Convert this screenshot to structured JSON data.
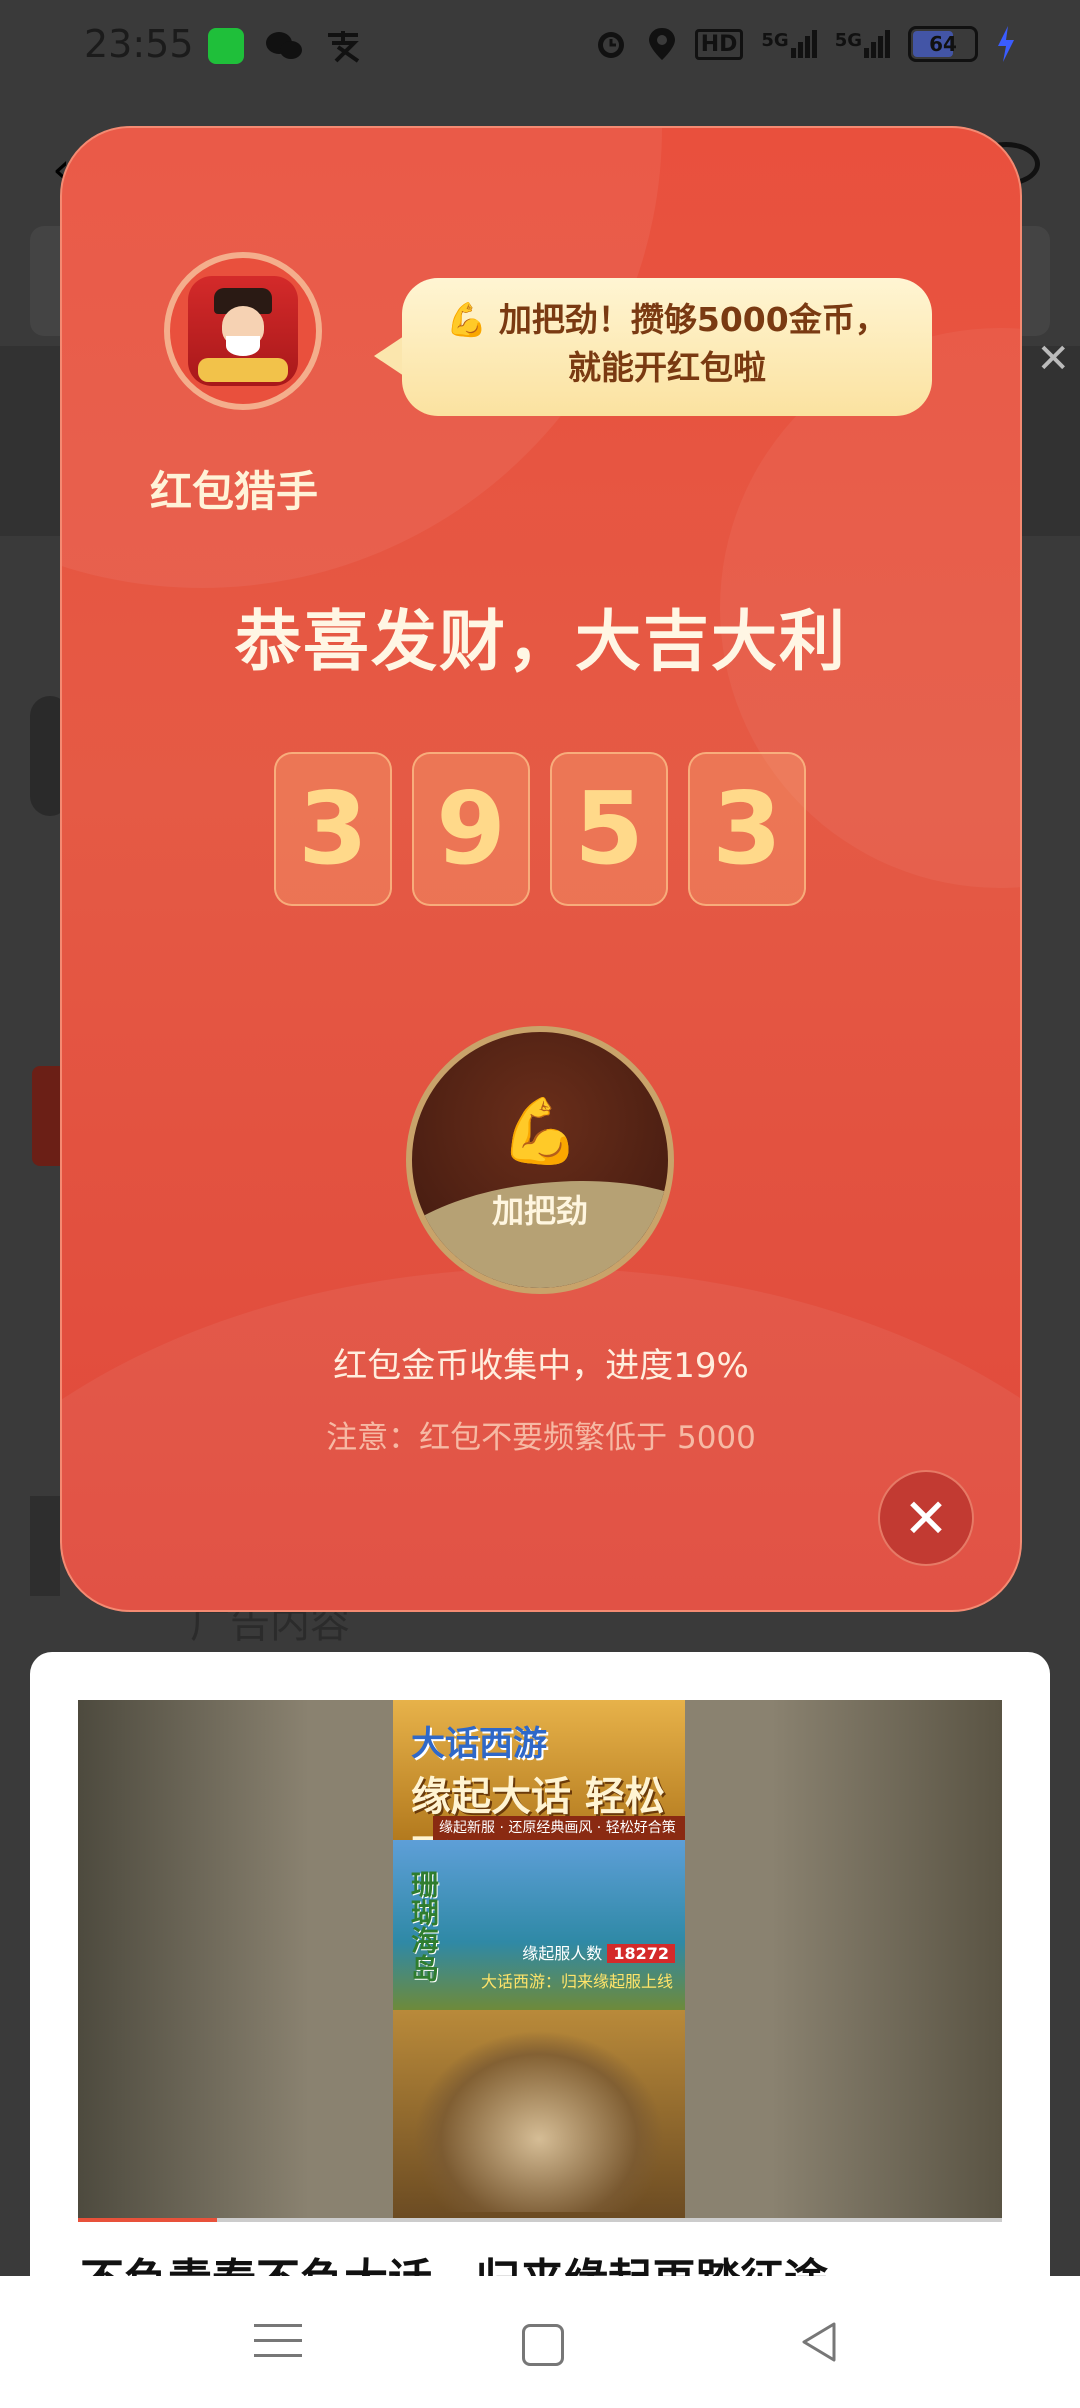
{
  "status_bar": {
    "time": "23:55",
    "left_icons": [
      "app-icon",
      "wechat-icon",
      "alipay-icon"
    ],
    "right_icons": [
      "alarm-icon",
      "location-icon",
      "hd-icon",
      "5g-signal-icon",
      "5g-signal-icon",
      "battery-icon",
      "charging-icon"
    ],
    "hd_label": "HD",
    "net1_label": "5G",
    "net2_label": "5G",
    "battery_level": "64"
  },
  "modal": {
    "hunter_name": "红包猎手",
    "bubble_line1": "💪 加把劲！攒够5000金币，",
    "bubble_line2": "就能开红包啦",
    "headline": "恭喜发财，大吉大利",
    "digits": [
      "3",
      "9",
      "5",
      "3"
    ],
    "boost_icon": "💪",
    "boost_label": "加把劲",
    "boost_fill_fraction": 0.19,
    "progress_text": "红包金币收集中，进度19%",
    "notice_text": "注意：红包不要频繁低于 5000",
    "close_label": "✕",
    "colors": {
      "background": "#e9503d",
      "digit_text": "#ffd98a",
      "bubble": "#fff5d3"
    }
  },
  "background_page": {
    "ad_label": "广告内容"
  },
  "ad_card": {
    "poster_title": "大话西游",
    "poster_slogan": "缘起大话 轻松西游",
    "poster_sub": "缘起新服 · 还原经典画风 · 轻松好合策略",
    "poster_isle": "珊瑚海岛",
    "poster_count_label": "缘起服人数",
    "poster_count": "18272",
    "poster_open": "大话西游：归来缘起服上线",
    "title": "不负青春不负大话，归来缘起再踏征途",
    "video_progress_fraction": 0.15
  },
  "nav_bar": {
    "items": [
      "menu-icon",
      "home-icon",
      "back-icon"
    ]
  }
}
